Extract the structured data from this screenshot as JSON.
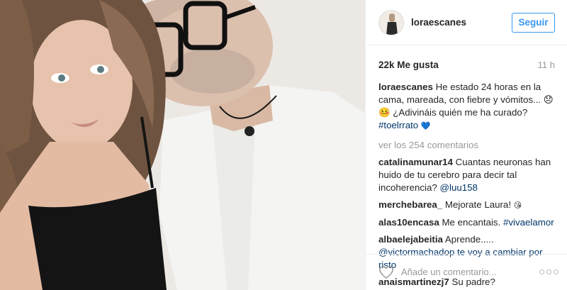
{
  "post": {
    "username": "loraescanes",
    "follow_label": "Seguir",
    "likes": "22k Me gusta",
    "time": "11 h",
    "caption": {
      "username": "loraescanes",
      "text": "He estado 24 horas en la cama, mareada, con fiebre y vómitos... 😞🤒 ¿Adivináis quién me ha curado?",
      "hashtag": "#toelrrato",
      "emoji": "💙"
    },
    "view_all": "ver los 254 comentarios",
    "comments": [
      {
        "username": "catalinamunar14",
        "text": "Cuantas neuronas han huido de tu cerebro para decir tal incoherencia?",
        "mention": "@luu158",
        "emoji": ""
      },
      {
        "username": "merchebarea_",
        "text": "Mejorate Laura!",
        "mention": "",
        "emoji": "😘"
      },
      {
        "username": "alas10encasa",
        "text": "Me encantais.",
        "mention": "#vivaelamor",
        "emoji": ""
      },
      {
        "username": "albaelejabeitia",
        "text": "Aprende.....",
        "mention": "@victormachado",
        "trailing": "p te voy a cambiar por risto",
        "emoji": ""
      },
      {
        "username": "anaismartinezj7",
        "text": "Su padre?",
        "mention": "",
        "emoji": ""
      }
    ],
    "add_comment_placeholder": "Añade un comentario...",
    "more_label": "○○○"
  },
  "icons": {
    "heart": "heart-icon",
    "more": "more-options-icon",
    "avatar": "avatar"
  },
  "colors": {
    "accent": "#3897f0",
    "link": "#003569",
    "muted": "#999999",
    "text": "#262626"
  }
}
